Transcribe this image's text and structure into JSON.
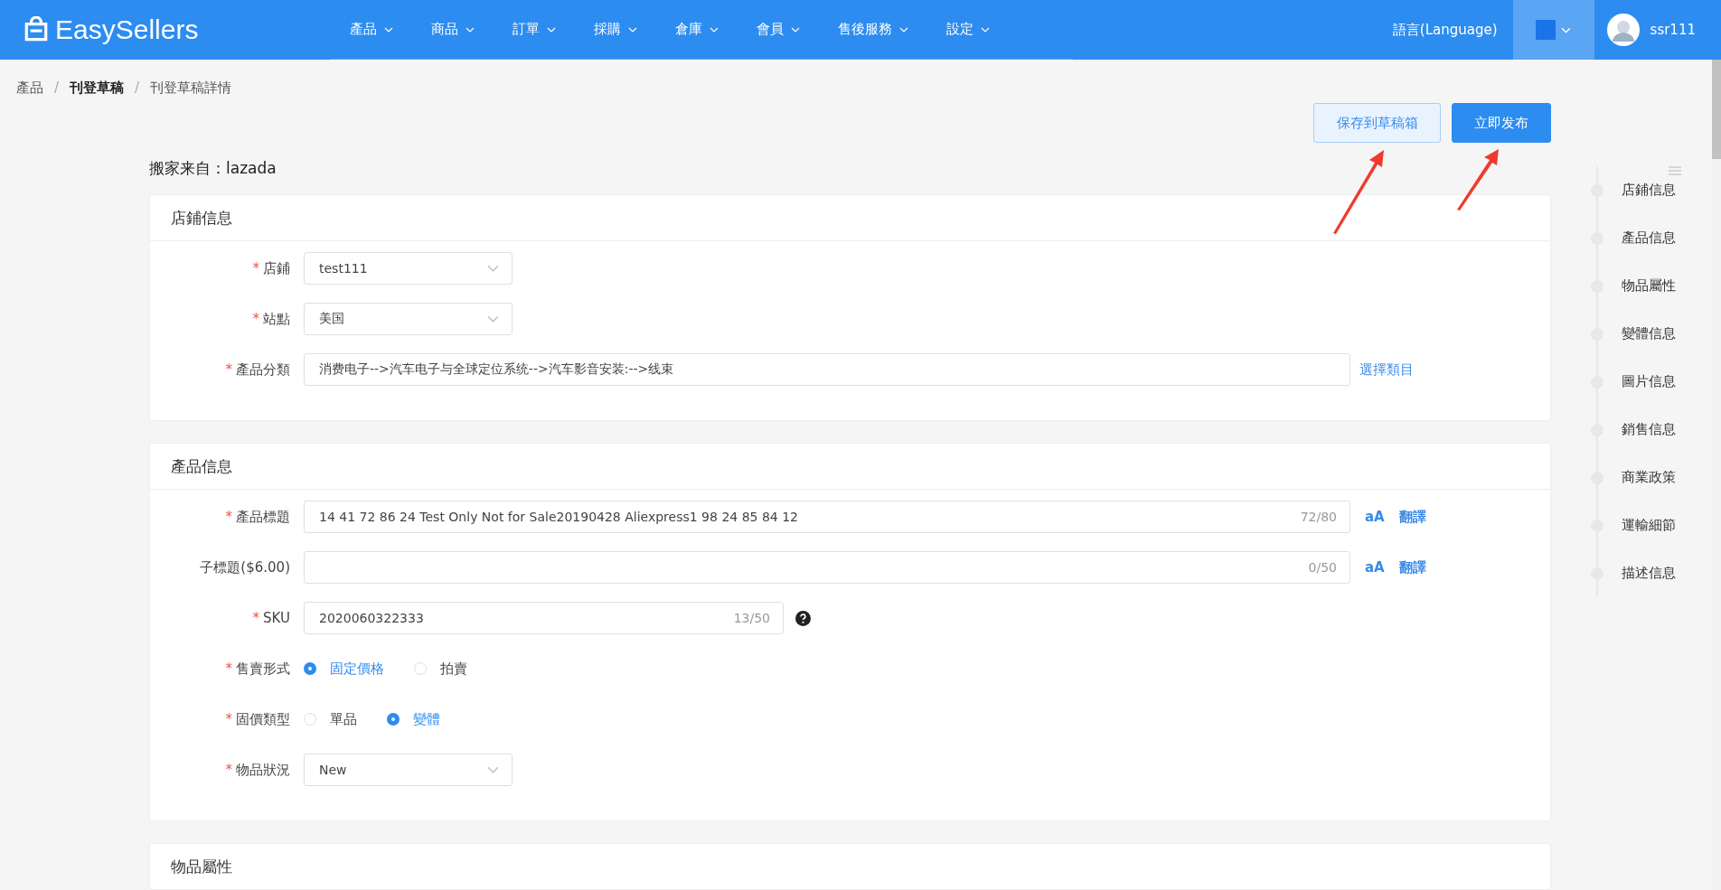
{
  "header": {
    "logo": "EasySellers",
    "nav": [
      {
        "label": "產品"
      },
      {
        "label": "商品"
      },
      {
        "label": "訂單"
      },
      {
        "label": "採購"
      },
      {
        "label": "倉庫"
      },
      {
        "label": "會員"
      },
      {
        "label": "售後服務"
      },
      {
        "label": "設定"
      }
    ],
    "language": "語言(Language)",
    "user": "ssr111"
  },
  "breadcrumb": {
    "separator": "/",
    "items": [
      {
        "label": "產品",
        "bold": false
      },
      {
        "label": "刊登草稿",
        "bold": true
      },
      {
        "label": "刊登草稿詳情",
        "bold": false
      }
    ]
  },
  "actions": [
    {
      "label": "保存到草稿箱",
      "kind": "plain"
    },
    {
      "label": "立即发布",
      "kind": "primary"
    }
  ],
  "source": {
    "label": "搬家来自：",
    "value": "lazada"
  },
  "sections": [
    {
      "title": "店鋪信息",
      "fields": [
        {
          "kind": "select",
          "label": "店鋪",
          "required_mark": "*",
          "value": "test111"
        },
        {
          "kind": "select",
          "label": "站點",
          "required_mark": "*",
          "value": "美国"
        },
        {
          "kind": "text",
          "label": "產品分類",
          "required_mark": "*",
          "value": "消费电子-->汽车电子与全球定位系统-->汽车影音安装:-->线束",
          "link": "選擇類目"
        }
      ]
    },
    {
      "title": "產品信息",
      "fields": [
        {
          "kind": "text",
          "label": "產品標題",
          "required_mark": "*",
          "value": "14 41 72 86 24 Test Only Not for Sale20190428 Aliexpress1 98 24 85 84 12",
          "counter": "72/80",
          "case": "aA",
          "link": "翻譯"
        },
        {
          "kind": "text",
          "label": "子標題($6.00)",
          "counter": "0/50",
          "case": "aA",
          "link": "翻譯"
        },
        {
          "kind": "text",
          "label": "SKU",
          "required_mark": "*",
          "value": "2020060322333",
          "counter": "13/50",
          "help": true
        },
        {
          "kind": "radio",
          "label": "售賣形式",
          "required_mark": "*",
          "options": [
            {
              "label": "固定價格",
              "selected": true
            },
            {
              "label": "拍賣",
              "selected": false
            }
          ]
        },
        {
          "kind": "radio",
          "label": "固價類型",
          "required_mark": "*",
          "options": [
            {
              "label": "單品",
              "selected": false
            },
            {
              "label": "變體",
              "selected": true
            }
          ]
        },
        {
          "kind": "select",
          "label": "物品狀況",
          "required_mark": "*",
          "value": "New"
        }
      ]
    },
    {
      "title": "物品屬性"
    }
  ],
  "anchors": [
    {
      "label": "店鋪信息"
    },
    {
      "label": "產品信息"
    },
    {
      "label": "物品屬性"
    },
    {
      "label": "變體信息"
    },
    {
      "label": "圖片信息"
    },
    {
      "label": "銷售信息"
    },
    {
      "label": "商業政策"
    },
    {
      "label": "運輸細節"
    },
    {
      "label": "描述信息"
    }
  ]
}
